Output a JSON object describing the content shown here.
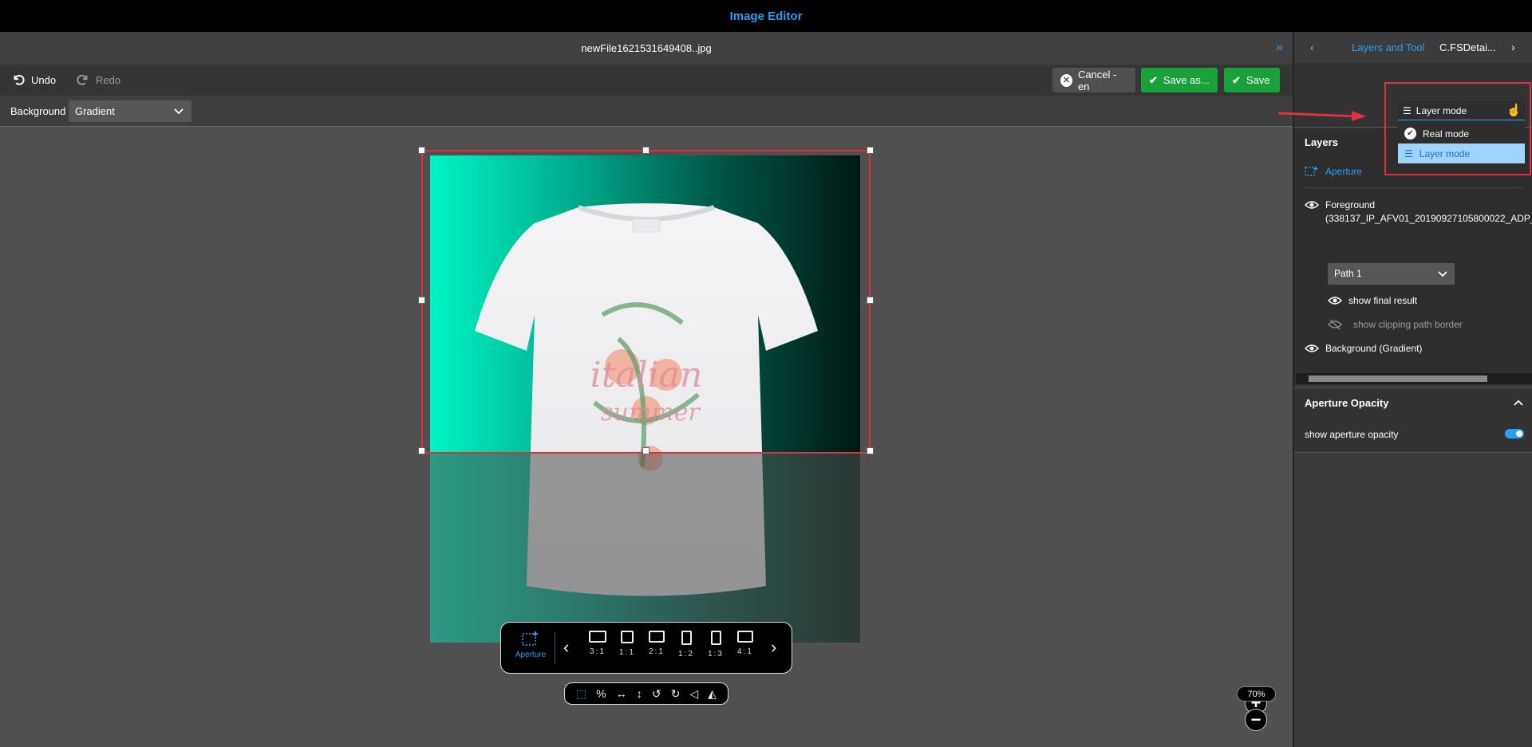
{
  "app": {
    "title": "Image Editor"
  },
  "file": {
    "name": "newFile1621531649408..jpg"
  },
  "toolbar": {
    "undo_label": "Undo",
    "redo_label": "Redo",
    "cancel_label": "Cancel - en",
    "save_as_label": "Save as...",
    "save_label": "Save"
  },
  "background_bar": {
    "label": "Background",
    "value": "Gradient"
  },
  "ratio_bar": {
    "aperture_label": "Aperture",
    "ratios": [
      "3:1",
      "1:1",
      "2:1",
      "1:2",
      "1:3",
      "4:1"
    ]
  },
  "zoom": {
    "value": "70%"
  },
  "right_panel": {
    "tabs": [
      "Layers and Tool",
      "C.FSDetai..."
    ],
    "mode_select": {
      "value": "Layer mode",
      "options": [
        "Real mode",
        "Layer mode"
      ]
    },
    "layers": {
      "heading": "Layers",
      "aperture": "Aperture",
      "foreground": "Foreground",
      "foreground_detail": "(338137_IP_AFV01_20190927105800022_ADP_",
      "path_select": "Path 1",
      "show_final_result": "show final result",
      "show_clipping": "show clipping path border",
      "background": "Background (Gradient)"
    },
    "opacity": {
      "heading": "Aperture Opacity",
      "toggle_label": "show aperture opacity",
      "toggle_on": true
    }
  },
  "colors": {
    "accent": "#2a9df4",
    "save_green": "#1aa23a",
    "highlight_red": "#e0303d"
  }
}
